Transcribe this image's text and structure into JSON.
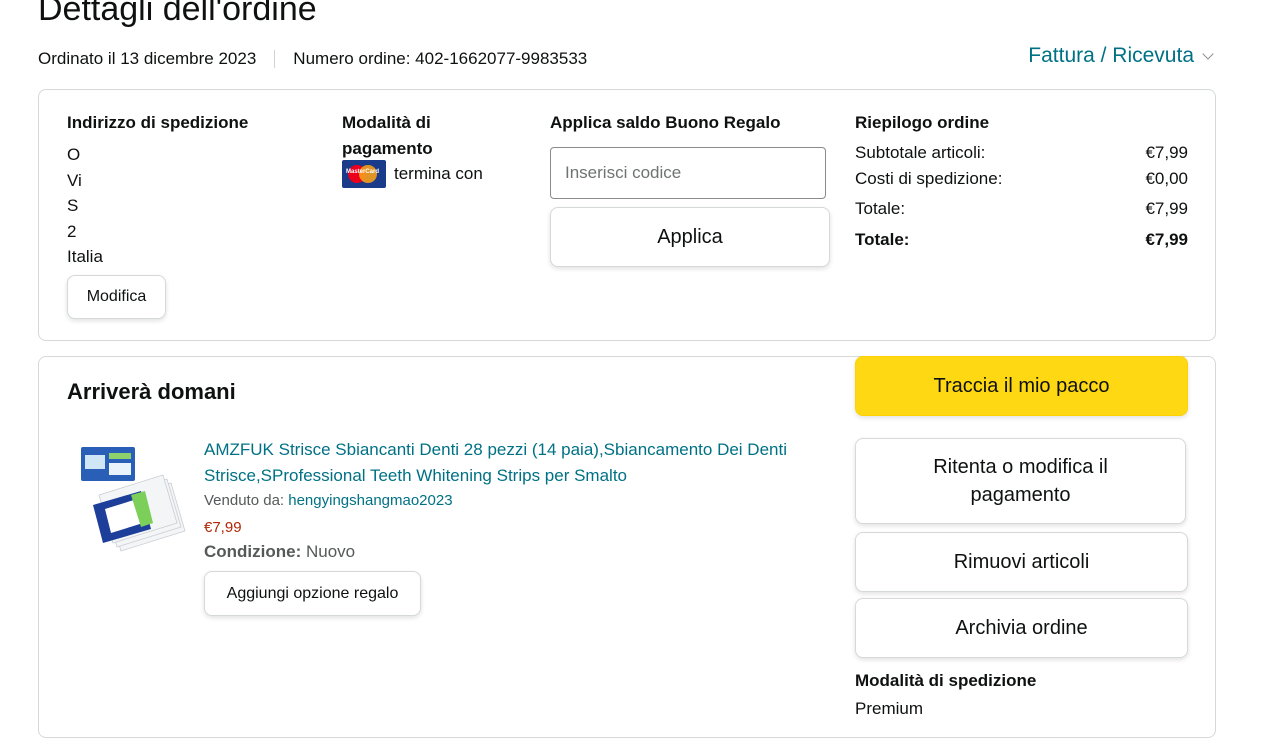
{
  "header": {
    "title": "Dettagli dell'ordine",
    "ordered_on": "Ordinato il 13 dicembre 2023",
    "order_number": "Numero ordine: 402-1662077-9983533",
    "invoice_label": "Fattura / Ricevuta"
  },
  "shipping_address": {
    "heading": "Indirizzo di spedizione",
    "lines": [
      "O",
      "Vi",
      "S",
      "2",
      "Italia"
    ],
    "edit_label": "Modifica"
  },
  "payment": {
    "heading": "Modalità di pagamento",
    "card_text": "termina con",
    "card_icon": "mastercard-icon"
  },
  "gift_card": {
    "heading": "Applica saldo Buono Regalo",
    "placeholder": "Inserisci codice",
    "apply_label": "Applica"
  },
  "summary": {
    "heading": "Riepilogo ordine",
    "rows": [
      {
        "label": "Subtotale articoli:",
        "value": "€7,99"
      },
      {
        "label": "Costi di spedizione:",
        "value": "€0,00"
      },
      {
        "label": "Totale:",
        "value": "€7,99"
      },
      {
        "label": "Totale:",
        "value": "€7,99"
      }
    ]
  },
  "shipment": {
    "title": "Arriverà domani",
    "product": {
      "title": "AMZFUK Strisce Sbiancanti Denti 28 pezzi (14 paia),Sbiancamento Dei Denti Strisce,SProfessional Teeth Whitening Strips per Smalto",
      "sold_by_label": "Venduto da:",
      "seller": "hengyingshangmao2023",
      "price": "€7,99",
      "condition_label": "Condizione:",
      "condition_value": "Nuovo",
      "gift_option_label": "Aggiungi opzione regalo"
    },
    "actions": {
      "track": "Traccia il mio pacco",
      "retry_payment": "Ritenta o modifica il pagamento",
      "remove": "Rimuovi articoli",
      "archive": "Archivia ordine"
    },
    "shipping_method_heading": "Modalità di spedizione",
    "shipping_method_value": "Premium"
  },
  "colors": {
    "link": "#007185",
    "price": "#b12704",
    "primary_button": "#ffd814",
    "border": "#d5d9d9"
  }
}
